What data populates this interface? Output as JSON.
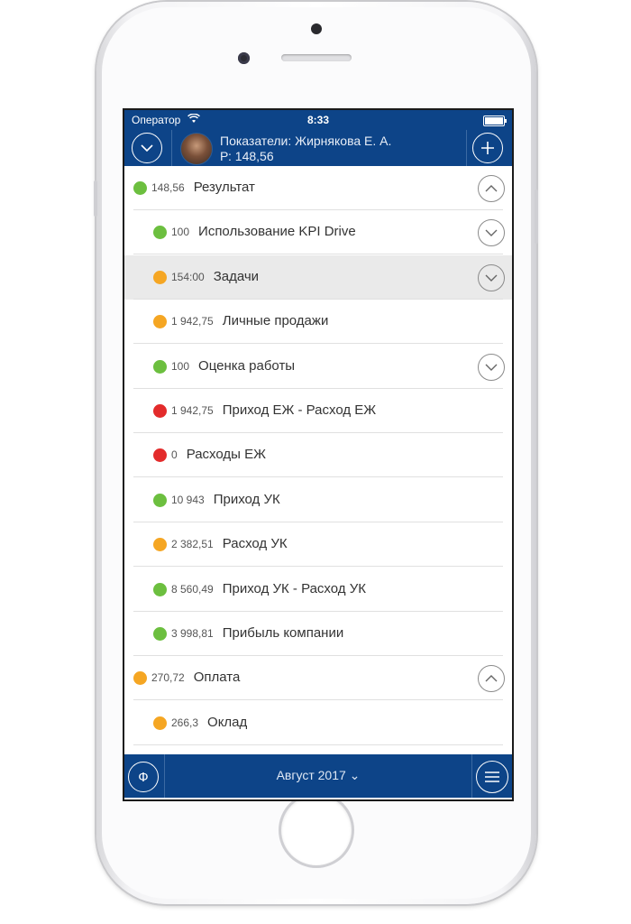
{
  "status": {
    "carrier": "Оператор",
    "time": "8:33"
  },
  "header": {
    "title": "Показатели: Жирнякова Е. А.",
    "subtitle": "Р: 148,56"
  },
  "colors": {
    "green": "#6cbf3f",
    "orange": "#f5a623",
    "red": "#e32b2b",
    "nav": "#0d4488"
  },
  "rows": [
    {
      "value": "148,56",
      "label": "Результат",
      "status": "green",
      "indent": 0,
      "chevron": "up"
    },
    {
      "value": "100",
      "label": "Использование KPI Drive",
      "status": "green",
      "indent": 1,
      "chevron": "down"
    },
    {
      "value": "154:00",
      "label": "Задачи",
      "status": "orange",
      "indent": 1,
      "chevron": "down",
      "highlight": true
    },
    {
      "value": "1 942,75",
      "label": "Личные продажи",
      "status": "orange",
      "indent": 1
    },
    {
      "value": "100",
      "label": "Оценка работы",
      "status": "green",
      "indent": 1,
      "chevron": "down"
    },
    {
      "value": "1 942,75",
      "label": "Приход ЕЖ - Расход ЕЖ",
      "status": "red",
      "indent": 1
    },
    {
      "value": "0",
      "label": "Расходы ЕЖ",
      "status": "red",
      "indent": 1
    },
    {
      "value": "10 943",
      "label": "Приход УК",
      "status": "green",
      "indent": 1
    },
    {
      "value": "2 382,51",
      "label": "Расход УК",
      "status": "orange",
      "indent": 1
    },
    {
      "value": "8 560,49",
      "label": "Приход УК - Расход УК",
      "status": "green",
      "indent": 1
    },
    {
      "value": "3 998,81",
      "label": "Прибыль компании",
      "status": "green",
      "indent": 1
    },
    {
      "value": "270,72",
      "label": "Оплата",
      "status": "orange",
      "indent": 0,
      "chevron": "up"
    },
    {
      "value": "266,3",
      "label": "Оклад",
      "status": "orange",
      "indent": 1
    }
  ],
  "footer": {
    "left_icon_label": "Ф",
    "period": "Август 2017 ⌄"
  }
}
